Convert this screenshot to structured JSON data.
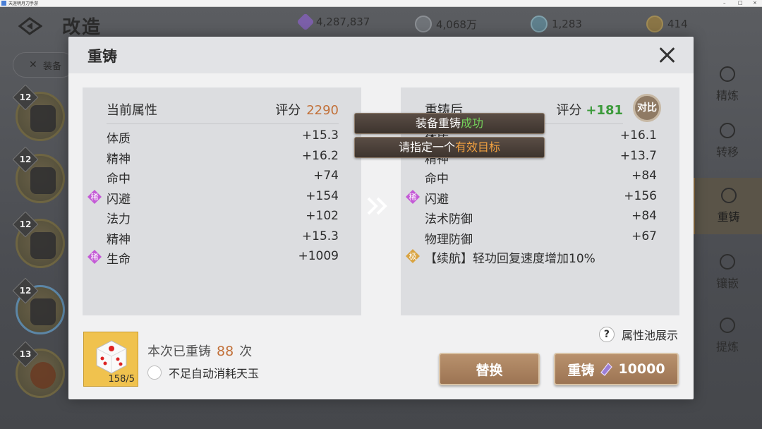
{
  "window": {
    "title": "天涯明月刀手游"
  },
  "background": {
    "page_title": "改造",
    "currencies": [
      {
        "icon": "purple-crystal-icon",
        "value": "4,287,837"
      },
      {
        "icon": "coin-icon",
        "value": "4,068万"
      },
      {
        "icon": "gem-icon",
        "value": "1,283"
      },
      {
        "icon": "gold-token-icon",
        "value": "414"
      }
    ],
    "filter_label": "装备",
    "equip_levels": [
      "12",
      "12",
      "12",
      "12",
      "13"
    ],
    "side_menu": [
      "精炼",
      "转移",
      "重铸",
      "镶嵌",
      "提炼"
    ],
    "active_side_item": "重铸"
  },
  "modal": {
    "title": "重铸",
    "left_panel": {
      "title": "当前属性",
      "score_label": "评分",
      "score_value": "2290",
      "stats": [
        {
          "name": "体质",
          "value": "+15.3",
          "rare": false
        },
        {
          "name": "精神",
          "value": "+16.2",
          "rare": false
        },
        {
          "name": "命中",
          "value": "+74",
          "rare": false
        },
        {
          "name": "闪避",
          "value": "+154",
          "rare": true
        },
        {
          "name": "法力",
          "value": "+102",
          "rare": false
        },
        {
          "name": "精神",
          "value": "+15.3",
          "rare": false
        },
        {
          "name": "生命",
          "value": "+1009",
          "rare": true
        }
      ]
    },
    "right_panel": {
      "title": "重铸后",
      "score_label": "评分",
      "score_delta": "+181",
      "compare_label": "对比",
      "stats": [
        {
          "name": "体质",
          "value": "+16.1",
          "rare": false
        },
        {
          "name": "精神",
          "value": "+13.7",
          "rare": false
        },
        {
          "name": "命中",
          "value": "+84",
          "rare": false
        },
        {
          "name": "闪避",
          "value": "+156",
          "rare": true
        },
        {
          "name": "法术防御",
          "value": "+84",
          "rare": false
        },
        {
          "name": "物理防御",
          "value": "+67",
          "rare": false
        }
      ],
      "special": {
        "badge": "极",
        "text": "【续航】轻功回复速度增加10%"
      }
    },
    "rare_badge_text": "稀",
    "toasts": [
      {
        "prefix": "装备重铸",
        "highlight": "成功"
      },
      {
        "prefix": "请指定一个",
        "highlight": "有效目标"
      }
    ],
    "dice_count": "158/5",
    "reforge_count": {
      "prefix": "本次已重铸",
      "value": "88",
      "suffix": "次"
    },
    "auto_consume_label": "不足自动消耗天玉",
    "pool_label": "属性池展示",
    "replace_button": "替换",
    "reforge_button": {
      "label": "重铸",
      "cost": "10000"
    }
  },
  "colors": {
    "score_orange": "#c2713a",
    "score_green": "#3b9a3a",
    "rare_purple": "#c45bd6",
    "special_gold": "#d9a442",
    "button_brown": "#9c7453"
  }
}
